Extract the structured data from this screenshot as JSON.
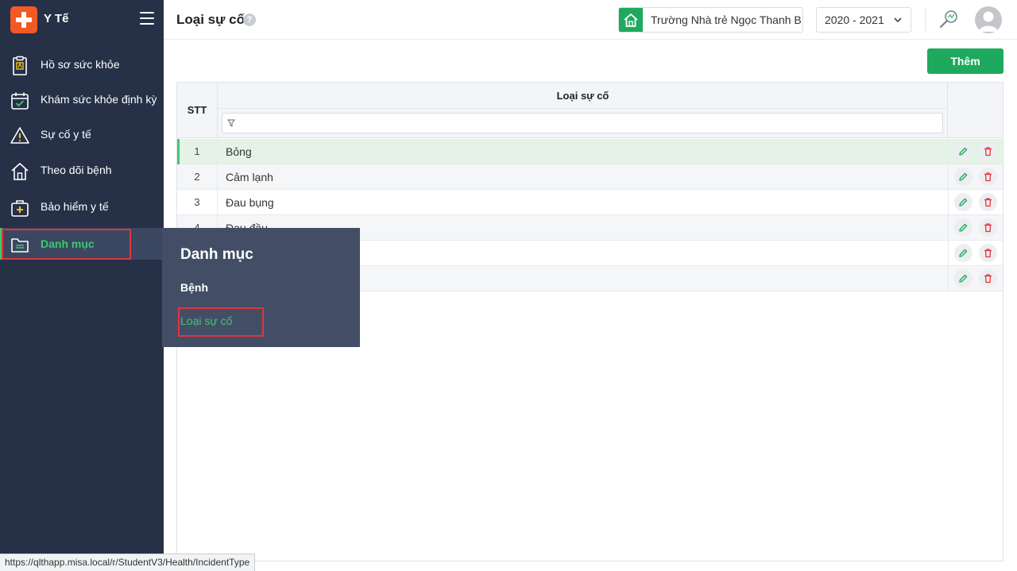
{
  "app": {
    "title": "Y Tế"
  },
  "sidebar": {
    "items": [
      {
        "label": "Hồ sơ sức khỏe",
        "icon": "clipboard-icon"
      },
      {
        "label": "Khám sức khỏe định kỳ",
        "icon": "calendar-check-icon"
      },
      {
        "label": "Sự cố y tế",
        "icon": "warning-icon"
      },
      {
        "label": "Theo dõi bệnh",
        "icon": "home-icon"
      },
      {
        "label": "Bảo hiểm y tế",
        "icon": "medical-bag-icon"
      },
      {
        "label": "Danh mục",
        "icon": "folder-icon",
        "active": true
      }
    ]
  },
  "flyout": {
    "title": "Danh mục",
    "items": [
      {
        "label": "Bệnh"
      },
      {
        "label": "Loại sự cố",
        "active": true
      }
    ]
  },
  "header": {
    "title": "Loại sự cố",
    "help": "?",
    "school": "Trường Nhà trẻ Ngọc Thanh B",
    "year": "2020 - 2021"
  },
  "toolbar": {
    "add_label": "Thêm"
  },
  "grid": {
    "columns": {
      "stt": "STT",
      "name": "Loại sự cố"
    },
    "rows": [
      {
        "stt": "1",
        "name": "Bỏng"
      },
      {
        "stt": "2",
        "name": "Cảm lạnh"
      },
      {
        "stt": "3",
        "name": "Đau bụng"
      },
      {
        "stt": "4",
        "name": "Đau đầu"
      },
      {
        "stt": "",
        "name": ""
      },
      {
        "stt": "",
        "name": ""
      }
    ]
  },
  "statusbar": {
    "url": "https://qlthapp.misa.local/r/StudentV3/Health/IncidentType"
  },
  "colors": {
    "sidebar": "#263148",
    "accent": "#1fa95e",
    "active_text": "#3ec96e",
    "highlight_box": "#e0343b"
  }
}
